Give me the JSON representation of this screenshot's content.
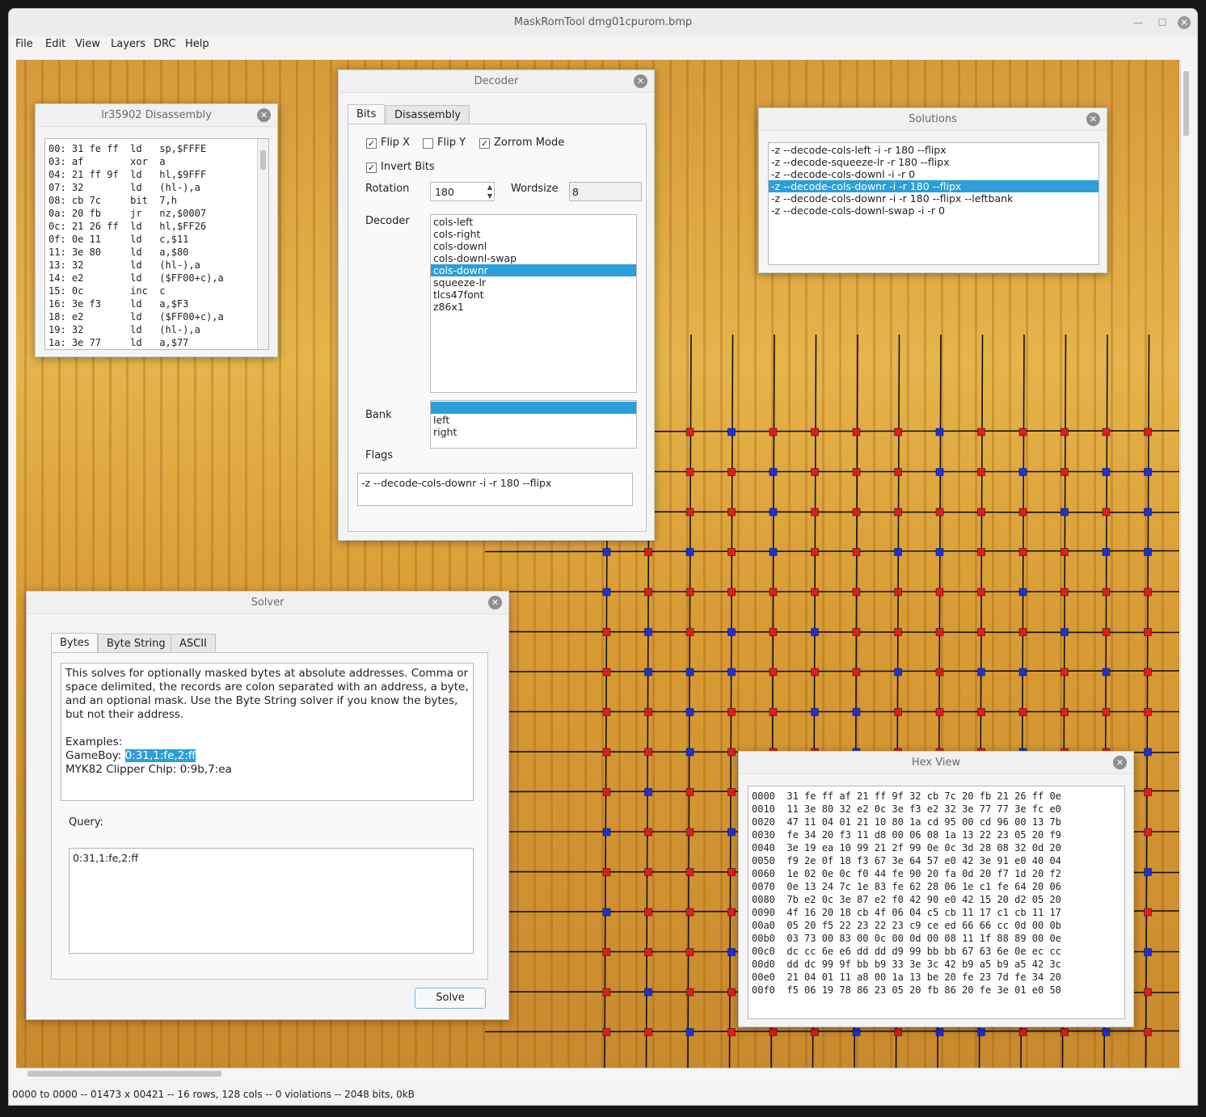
{
  "window": {
    "title": "MaskRomTool dmg01cpurom.bmp"
  },
  "menu": [
    "File",
    "Edit",
    "View",
    "Layers",
    "DRC",
    "Help"
  ],
  "status": "0000 to 0000 -- 01473 x 00421 -- 16 rows, 128 cols --  0 violations -- 2048 bits, 0kB",
  "disasm": {
    "title": "lr35902 Disassembly",
    "lines": [
      "00: 31 fe ff  ld   sp,$FFFE",
      "03: af        xor  a",
      "04: 21 ff 9f  ld   hl,$9FFF",
      "07: 32        ld   (hl-),a",
      "08: cb 7c     bit  7,h",
      "0a: 20 fb     jr   nz,$0007",
      "0c: 21 26 ff  ld   hl,$FF26",
      "0f: 0e 11     ld   c,$11",
      "11: 3e 80     ld   a,$80",
      "13: 32        ld   (hl-),a",
      "14: e2        ld   ($FF00+c),a",
      "15: 0c        inc  c",
      "16: 3e f3     ld   a,$F3",
      "18: e2        ld   ($FF00+c),a",
      "19: 32        ld   (hl-),a",
      "1a: 3e 77     ld   a,$77"
    ]
  },
  "decoder": {
    "title": "Decoder",
    "tabs": [
      "Bits",
      "Disassembly"
    ],
    "flipx": "Flip X",
    "flipy": "Flip Y",
    "zorrom": "Zorrom Mode",
    "invert": "Invert Bits",
    "rotation_label": "Rotation",
    "rotation": "180",
    "wordsize_label": "Wordsize",
    "wordsize": "8",
    "decoder_label": "Decoder",
    "decoders": [
      "cols-left",
      "cols-right",
      "cols-downl",
      "cols-downl-swap",
      "cols-downr",
      "squeeze-lr",
      "tlcs47font",
      "z86x1"
    ],
    "selected_decoder": 4,
    "bank_label": "Bank",
    "banks": [
      "",
      "left",
      "right"
    ],
    "flags_label": "Flags",
    "flags": "-z --decode-cols-downr -i -r 180 --flipx"
  },
  "solutions": {
    "title": "Solutions",
    "items": [
      "-z --decode-cols-left -i -r 180 --flipx",
      "-z --decode-squeeze-lr -r 180 --flipx",
      "-z --decode-cols-downl -i -r 0",
      "-z --decode-cols-downr -i -r 180 --flipx",
      "-z --decode-cols-downr -i -r 180 --flipx --leftbank",
      "-z --decode-cols-downl-swap -i -r 0"
    ],
    "selected": 3
  },
  "solver": {
    "title": "Solver",
    "tabs": [
      "Bytes",
      "Byte String",
      "ASCII"
    ],
    "description": [
      "This solves for optionally masked bytes at absolute addresses.  Comma or",
      "space delimited, the records are colon separated with an address, a byte,",
      "and an optional mask.  Use the Byte String solver if you know the bytes,",
      "but not their address."
    ],
    "examples_label": "Examples:",
    "gameboy_label": "GameBoy: ",
    "gameboy_value": "0:31,1:fe,2:ff",
    "myk82": "MYK82 Clipper Chip: 0:9b,7:ea",
    "query_label": "Query:",
    "query": "0:31,1:fe,2:ff",
    "solve": "Solve"
  },
  "hexview": {
    "title": "Hex View",
    "rows": [
      "0000  31 fe ff af 21 ff 9f 32 cb 7c 20 fb 21 26 ff 0e",
      "0010  11 3e 80 32 e2 0c 3e f3 e2 32 3e 77 77 3e fc e0",
      "0020  47 11 04 01 21 10 80 1a cd 95 00 cd 96 00 13 7b",
      "0030  fe 34 20 f3 11 d8 00 06 08 1a 13 22 23 05 20 f9",
      "0040  3e 19 ea 10 99 21 2f 99 0e 0c 3d 28 08 32 0d 20",
      "0050  f9 2e 0f 18 f3 67 3e 64 57 e0 42 3e 91 e0 40 04",
      "0060  1e 02 0e 0c f0 44 fe 90 20 fa 0d 20 f7 1d 20 f2",
      "0070  0e 13 24 7c 1e 83 fe 62 28 06 1e c1 fe 64 20 06",
      "0080  7b e2 0c 3e 87 e2 f0 42 90 e0 42 15 20 d2 05 20",
      "0090  4f 16 20 18 cb 4f 06 04 c5 cb 11 17 c1 cb 11 17",
      "00a0  05 20 f5 22 23 22 23 c9 ce ed 66 66 cc 0d 00 0b",
      "00b0  03 73 00 83 00 0c 00 0d 00 08 11 1f 88 89 00 0e",
      "00c0  dc cc 6e e6 dd dd d9 99 bb bb 67 63 6e 0e ec cc",
      "00d0  dd dc 99 9f bb b9 33 3e 3c 42 b9 a5 b9 a5 42 3c",
      "00e0  21 04 01 11 a8 00 1a 13 be 20 fe 23 7d fe 34 20",
      "00f0  f5 06 19 78 86 23 05 20 fb 86 20 fe 3e 01 e0 50"
    ]
  },
  "colors": {
    "bit_one": "#e41b1b",
    "bit_zero": "#1a2fe0",
    "selection": "#2c9fd9"
  }
}
